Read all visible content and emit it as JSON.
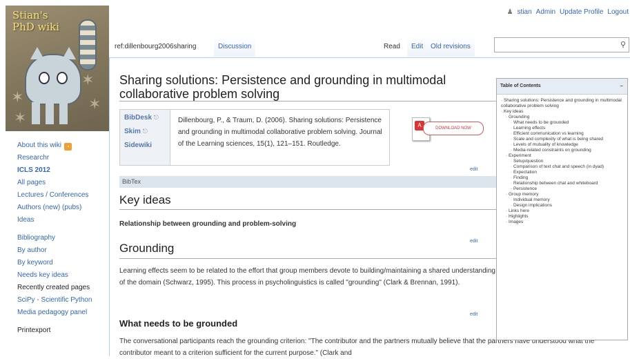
{
  "logo": {
    "title": "Stian's\nPhD wiki"
  },
  "userbar": {
    "user": "stian",
    "links": [
      "Admin",
      "Update Profile",
      "Logout"
    ]
  },
  "sidebar": {
    "items": [
      {
        "label": "About this wiki",
        "style": "link",
        "rss": true
      },
      {
        "label": "Researchr",
        "style": "link"
      },
      {
        "label": "ICLS 2012",
        "style": "bold"
      },
      {
        "label": "All pages",
        "style": "link"
      },
      {
        "label": "Lectures / Conferences",
        "style": "link"
      },
      {
        "label": "Authors (new) (pubs)",
        "style": "link"
      },
      {
        "label": "Ideas",
        "style": "link"
      }
    ],
    "items2": [
      {
        "label": "Bibliography",
        "style": "link"
      },
      {
        "label": "By author",
        "style": "link"
      },
      {
        "label": "By keyword",
        "style": "link"
      },
      {
        "label": "Needs key ideas",
        "style": "link"
      },
      {
        "label": "Recently created pages",
        "style": "dark"
      },
      {
        "label": "SciPy - Scientific Python",
        "style": "link"
      },
      {
        "label": "Media pedagogy panel",
        "style": "link"
      }
    ],
    "last": "Printexport"
  },
  "tabs": {
    "page": "ref:dillenbourg2006sharing",
    "discussion": "Discussion",
    "read": "Read",
    "edit": "Edit",
    "revisions": "Old revisions"
  },
  "content": {
    "title": "Sharing solutions: Persistence and grounding in multimodal collaborative problem solving",
    "bib_labels": [
      "BibDesk",
      "Skim",
      "Sidewiki"
    ],
    "citation": "Dillenbourg, P., & Traum, D. (2006). Sharing solutions: Persistence and grounding in multimodal collaborative problem solving. Journal of the Learning sciences, 15(1), 121–151. Routledge.",
    "pdf_button": "DOWNLOAD NOW",
    "edit": "edit",
    "bibtex": "BibTex",
    "h_key_ideas": "Key ideas",
    "key_ideas_bold": "Relationship between grounding and problem-solving",
    "h_grounding": "Grounding",
    "grounding_para": "Learning effects seem to be related to the effort that group members devote to building/maintaining a shared understanding of the domain (Schwarz, 1995). This process in psycholinguistics is called \"grounding\" (Clark & Brennan, 1991).",
    "h_what": "What needs to be grounded",
    "what_para": "The conversational participants reach the grounding criterion: \"The contributor and the partners mutually believe that the partners have understood what the contributor meant to a criterion sufficient for the current purpose.\" (Clark and"
  },
  "toc": {
    "title": "Table of Contents",
    "toggle": "–",
    "items": [
      {
        "level": 1,
        "text": "Sharing solutions: Persistence and grounding in multimodal collaborative problem solving"
      },
      {
        "level": 1,
        "text": "Key ideas"
      },
      {
        "level": 2,
        "text": "Grounding"
      },
      {
        "level": 3,
        "text": "What needs to be grounded"
      },
      {
        "level": 3,
        "text": "Learning effects"
      },
      {
        "level": 3,
        "text": "Efficient communication vs learning"
      },
      {
        "level": 3,
        "text": "Scale and complexity of what is being shared"
      },
      {
        "level": 3,
        "text": "Levels of mutuality of knowledge"
      },
      {
        "level": 3,
        "text": "Media-related constraints on grounding"
      },
      {
        "level": 2,
        "text": "Experiment"
      },
      {
        "level": 3,
        "text": "Setup/question"
      },
      {
        "level": 3,
        "text": "Comparison of text chat and speech (in dyad)"
      },
      {
        "level": 3,
        "text": "Expectation"
      },
      {
        "level": 3,
        "text": "Finding"
      },
      {
        "level": 3,
        "text": "Relationship between chat and whiteboard"
      },
      {
        "level": 3,
        "text": "Persistence"
      },
      {
        "level": 2,
        "text": "Group memory"
      },
      {
        "level": 3,
        "text": "Individual memory"
      },
      {
        "level": 3,
        "text": "Design implications"
      },
      {
        "level": 2,
        "text": "Links here"
      },
      {
        "level": 2,
        "text": "Highlights"
      },
      {
        "level": 2,
        "text": "Images"
      }
    ]
  }
}
